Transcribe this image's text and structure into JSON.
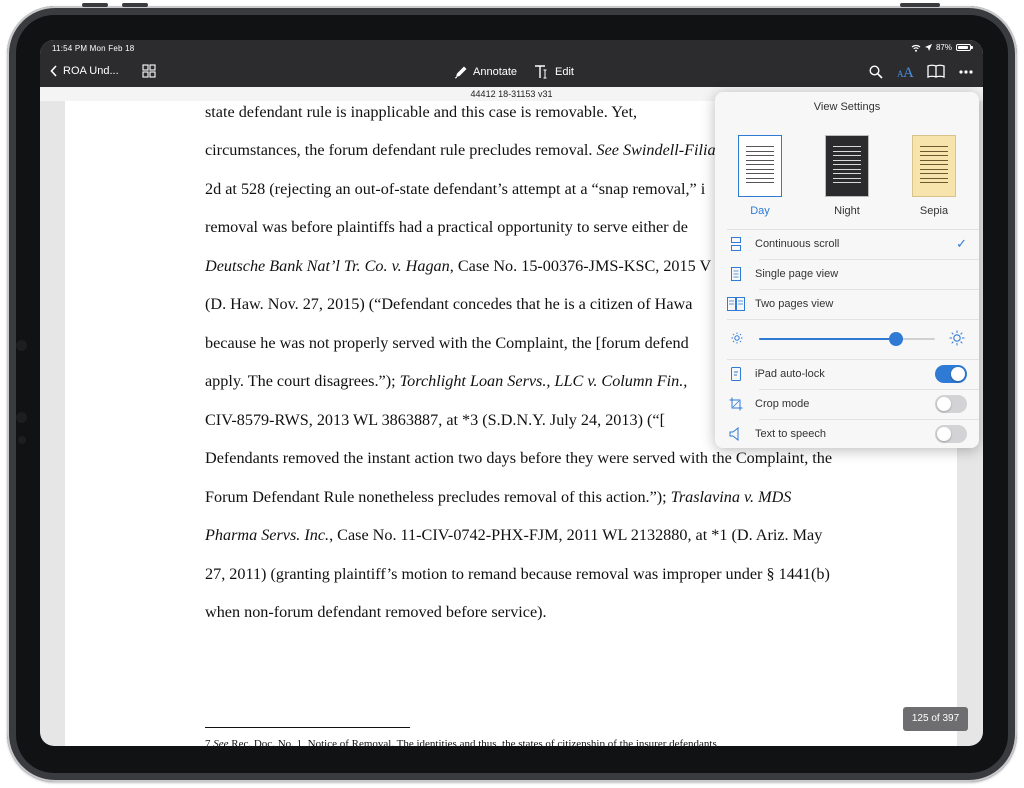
{
  "status_bar": {
    "time_date": "11:54 PM  Mon Feb 18",
    "battery": "87%",
    "battery_level": 0.87
  },
  "toolbar": {
    "back_label": "ROA Und...",
    "annotate_label": "Annotate",
    "edit_label": "Edit"
  },
  "document": {
    "id_label": "44412 18-31153 v31",
    "lines": [
      [
        {
          "t": "state defendant rule is inapplicable and this case is removable.   Yet,"
        }
      ],
      [
        {
          "t": "circumstances, the forum defendant rule precludes removal. "
        },
        {
          "t": "See Swindell-Filia",
          "i": true
        }
      ],
      [
        {
          "t": "2d at 528 (rejecting an out-of-state defendant’s attempt at a “snap removal,” i"
        }
      ],
      [
        {
          "t": "removal was before plaintiffs had a practical opportunity to serve either de"
        }
      ],
      [
        {
          "t": "Deutsche Bank Nat’l Tr. Co. v. Hagan",
          "i": true
        },
        {
          "t": ", Case No. 15-00376-JMS-KSC, 2015 V"
        }
      ],
      [
        {
          "t": "(D. Haw. Nov. 27, 2015) (“Defendant concedes that he is a citizen of Hawa"
        }
      ],
      [
        {
          "t": "because he was not properly served with the Complaint, the [forum defend"
        }
      ],
      [
        {
          "t": "apply.  The court disagrees.”); "
        },
        {
          "t": "Torchlight Loan Servs., LLC v. Column Fin.,",
          "i": true
        }
      ],
      [
        {
          "t": "CIV-8579-RWS, 2013 WL 3863887, at *3 (S.D.N.Y. July 24, 2013) (“["
        }
      ],
      [
        {
          "t": "Defendants removed the instant action two days before they were served with the Complaint, the"
        }
      ],
      [
        {
          "t": "Forum Defendant Rule nonetheless precludes removal of this action.”); "
        },
        {
          "t": "Traslavina v. MDS",
          "i": true
        }
      ],
      [
        {
          "t": "Pharma Servs. Inc.",
          "i": true
        },
        {
          "t": ", Case No. 11-CIV-0742-PHX-FJM, 2011 WL 2132880, at *1 (D. Ariz. May"
        }
      ],
      [
        {
          "t": "27, 2011) (granting plaintiff’s motion to remand because removal was improper under § 1441(b)"
        }
      ],
      [
        {
          "t": "when non-forum defendant removed before service)."
        }
      ]
    ],
    "footnote": [
      {
        "t": "7 "
      },
      {
        "t": "See",
        "i": true
      },
      {
        "t": " Rec. Doc. No. 1, Notice of Removal. The identities and thus, the states of citizenship of the insurer defendants,"
      }
    ],
    "page_counter": "125 of 397"
  },
  "view_settings": {
    "title": "View Settings",
    "themes": [
      {
        "label": "Day",
        "bg": "#ffffff",
        "line": "#555555",
        "label_color": "#2e7ad4",
        "selected": true
      },
      {
        "label": "Night",
        "bg": "#2b2b2d",
        "line": "#d9d9d9",
        "label_color": "#333333",
        "selected": false
      },
      {
        "label": "Sepia",
        "bg": "#f7e4ad",
        "line": "#6b5a2e",
        "label_color": "#333333",
        "selected": false
      }
    ],
    "layout_options": [
      {
        "label": "Continuous scroll",
        "icon": "continuous-scroll-icon",
        "checked": true
      },
      {
        "label": "Single page view",
        "icon": "single-page-icon",
        "checked": false
      },
      {
        "label": "Two pages view",
        "icon": "two-pages-icon",
        "checked": false
      }
    ],
    "brightness": 0.78,
    "toggles": [
      {
        "label": "iPad auto-lock",
        "icon": "auto-lock-icon",
        "on": true
      },
      {
        "label": "Crop mode",
        "icon": "crop-icon",
        "on": false
      },
      {
        "label": "Text to speech",
        "icon": "speaker-icon",
        "on": false
      }
    ]
  },
  "colors": {
    "accent": "#2e7ad4",
    "toolbar_bg": "#2c2c2e",
    "toggle_off": "#d3d3d6"
  }
}
